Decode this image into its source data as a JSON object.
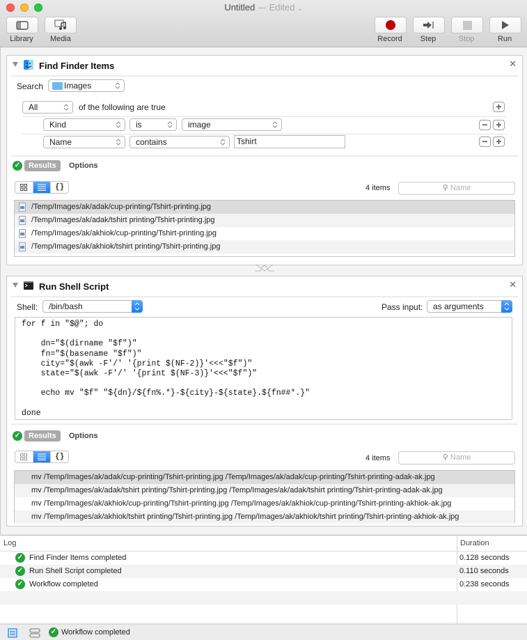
{
  "window": {
    "title": "Untitled",
    "title_separator": "—",
    "edited": "Edited"
  },
  "toolbar": {
    "library": "Library",
    "media": "Media",
    "record": "Record",
    "step": "Step",
    "stop": "Stop",
    "run": "Run"
  },
  "find_action": {
    "title": "Find Finder Items",
    "search_label": "Search",
    "search_location": "Images",
    "match_mode": "All",
    "match_text": "of the following are true",
    "conditions": [
      {
        "field": "Kind",
        "operator": "is",
        "value": "image"
      },
      {
        "field": "Name",
        "operator": "contains",
        "value": "Tshirt"
      }
    ],
    "results_tab": "Results",
    "options_tab": "Options",
    "item_count": "4 items",
    "search_placeholder": "Name",
    "results": [
      "/Temp/Images/ak/adak/cup-printing/Tshirt-printing.jpg",
      "/Temp/Images/ak/adak/tshirt printing/Tshirt-printing.jpg",
      "/Temp/Images/ak/akhiok/cup-printing/Tshirt-printing.jpg",
      "/Temp/Images/ak/akhiok/tshirt printing/Tshirt-printing.jpg"
    ]
  },
  "shell_action": {
    "title": "Run Shell Script",
    "shell_label": "Shell:",
    "shell_value": "/bin/bash",
    "pass_input_label": "Pass input:",
    "pass_input_value": "as arguments",
    "script": "for f in \"$@\"; do\n\n    dn=\"$(dirname \"$f\")\"\n    fn=\"$(basename \"$f\")\"\n    city=\"$(awk -F'/' '{print $(NF-2)}'<<<\"$f\")\"\n    state=\"$(awk -F'/' '{print $(NF-3)}'<<<\"$f\")\"\n\n    echo mv \"$f\" \"${dn}/${fn%.*}-${city}-${state}.${fn##*.}\"\n\ndone",
    "results_tab": "Results",
    "options_tab": "Options",
    "item_count": "4 items",
    "search_placeholder": "Name",
    "results": [
      "mv /Temp/Images/ak/adak/cup-printing/Tshirt-printing.jpg /Temp/Images/ak/adak/cup-printing/Tshirt-printing-adak-ak.jpg",
      "mv /Temp/Images/ak/adak/tshirt printing/Tshirt-printing.jpg /Temp/Images/ak/adak/tshirt printing/Tshirt-printing-adak-ak.jpg",
      "mv /Temp/Images/ak/akhiok/cup-printing/Tshirt-printing.jpg /Temp/Images/ak/akhiok/cup-printing/Tshirt-printing-akhiok-ak.jpg",
      "mv /Temp/Images/ak/akhiok/tshirt printing/Tshirt-printing.jpg /Temp/Images/ak/akhiok/tshirt printing/Tshirt-printing-akhiok-ak.jpg"
    ]
  },
  "log": {
    "col_log": "Log",
    "col_duration": "Duration",
    "entries": [
      {
        "message": "Find Finder Items completed",
        "duration": "0.128 seconds"
      },
      {
        "message": "Run Shell Script completed",
        "duration": "0.110 seconds"
      },
      {
        "message": "Workflow completed",
        "duration": "0.238 seconds"
      }
    ]
  },
  "statusbar": {
    "message": "Workflow completed"
  },
  "colors": {
    "success": "#24a13c",
    "accent": "#1c7cf3",
    "record": "#c00000"
  }
}
